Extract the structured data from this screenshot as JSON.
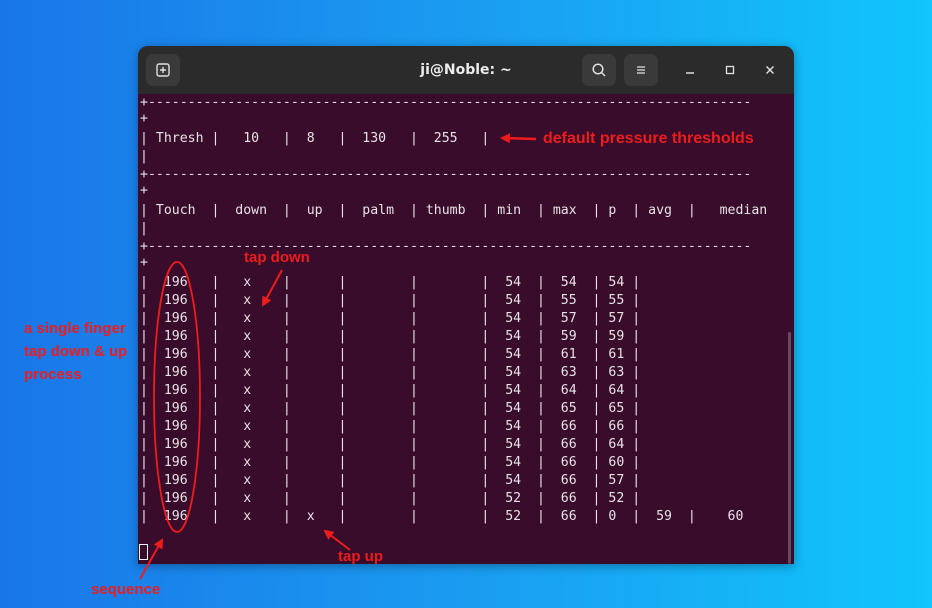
{
  "window": {
    "title": "ji@Noble: ~",
    "new_tab_icon": "new-tab-icon",
    "search_icon": "search-icon",
    "menu_icon": "hamburger-menu-icon",
    "minimize_icon": "minimize-icon",
    "maximize_icon": "maximize-icon",
    "close_icon": "close-icon"
  },
  "terminal": {
    "lines": [
      "+----------------------------------------------------------------------------",
      "+",
      "| Thresh |   10   |  8   |  130   |  255   |",
      "|",
      "+----------------------------------------------------------------------------",
      "+",
      "| Touch  |  down  |  up  |  palm  | thumb  | min  | max  | p  | avg  |   median",
      "|",
      "+----------------------------------------------------------------------------",
      "+",
      "|  196   |   x    |      |        |        |  54  |  54  | 54 |",
      "|  196   |   x    |      |        |        |  54  |  55  | 55 |",
      "|  196   |   x    |      |        |        |  54  |  57  | 57 |",
      "|  196   |   x    |      |        |        |  54  |  59  | 59 |",
      "|  196   |   x    |      |        |        |  54  |  61  | 61 |",
      "|  196   |   x    |      |        |        |  54  |  63  | 63 |",
      "|  196   |   x    |      |        |        |  54  |  64  | 64 |",
      "|  196   |   x    |      |        |        |  54  |  65  | 65 |",
      "|  196   |   x    |      |        |        |  54  |  66  | 66 |",
      "|  196   |   x    |      |        |        |  54  |  66  | 64 |",
      "|  196   |   x    |      |        |        |  54  |  66  | 60 |",
      "|  196   |   x    |      |        |        |  54  |  66  | 57 |",
      "|  196   |   x    |      |        |        |  52  |  66  | 52 |",
      "|  196   |   x    |  x   |        |        |  52  |  66  | 0  |  59  |    60"
    ]
  },
  "annotations": {
    "default_thresholds": "default pressure  thresholds",
    "tap_down": "tap down",
    "tap_up": "tap up",
    "single_finger": [
      "a single finger",
      "tap down & up",
      "process"
    ],
    "sequence": "sequence",
    "color": "#ee1c1c"
  },
  "colors": {
    "terminal_bg": "#380c2a",
    "titlebar_bg": "#2b2b2b",
    "terminal_text": "#e8e2e6"
  }
}
